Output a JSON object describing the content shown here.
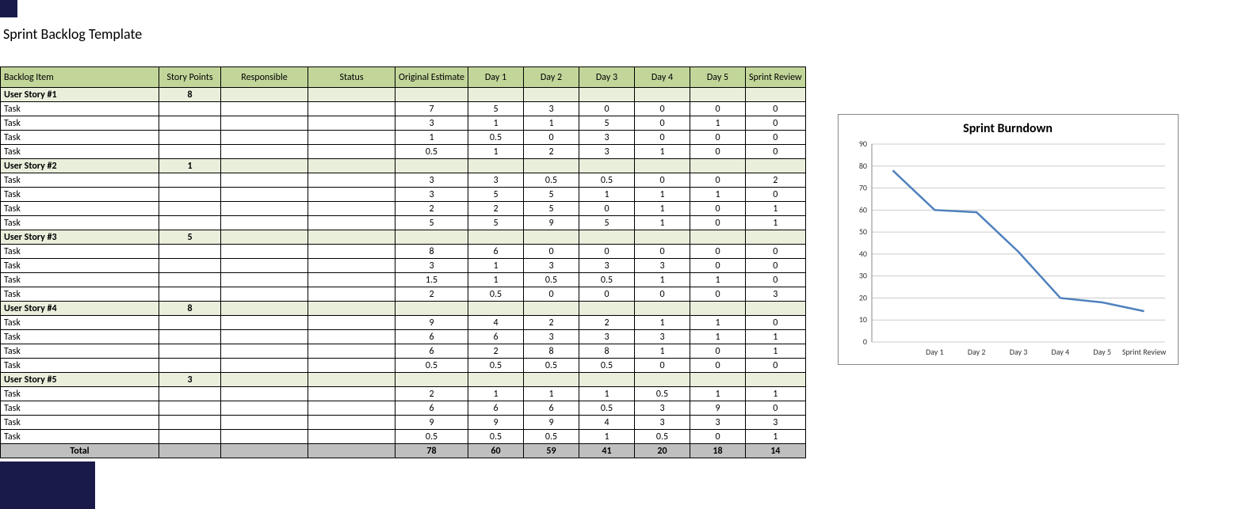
{
  "title": "Sprint Backlog Template",
  "headers": [
    "Backlog Item",
    "Story Points",
    "Responsible",
    "Status",
    "Original Estimate",
    "Day 1",
    "Day 2",
    "Day 3",
    "Day 4",
    "Day 5",
    "Sprint Review"
  ],
  "stories": [
    {
      "name": "User Story #1",
      "points": "8",
      "tasks": [
        {
          "name": "Task",
          "vals": [
            "7",
            "5",
            "3",
            "0",
            "0",
            "0",
            "0"
          ]
        },
        {
          "name": "Task",
          "vals": [
            "3",
            "1",
            "1",
            "5",
            "0",
            "1",
            "0"
          ]
        },
        {
          "name": "Task",
          "vals": [
            "1",
            "0.5",
            "0",
            "3",
            "0",
            "0",
            "0"
          ]
        },
        {
          "name": "Task",
          "vals": [
            "0.5",
            "1",
            "2",
            "3",
            "1",
            "0",
            "0"
          ]
        }
      ]
    },
    {
      "name": "User Story #2",
      "points": "1",
      "tasks": [
        {
          "name": "Task",
          "vals": [
            "3",
            "3",
            "0.5",
            "0.5",
            "0",
            "0",
            "2"
          ]
        },
        {
          "name": "Task",
          "vals": [
            "3",
            "5",
            "5",
            "1",
            "1",
            "1",
            "0"
          ]
        },
        {
          "name": "Task",
          "vals": [
            "2",
            "2",
            "5",
            "0",
            "1",
            "0",
            "1"
          ]
        },
        {
          "name": "Task",
          "vals": [
            "5",
            "5",
            "9",
            "5",
            "1",
            "0",
            "1"
          ]
        }
      ]
    },
    {
      "name": "User Story #3",
      "points": "5",
      "tasks": [
        {
          "name": "Task",
          "vals": [
            "8",
            "6",
            "0",
            "0",
            "0",
            "0",
            "0"
          ]
        },
        {
          "name": "Task",
          "vals": [
            "3",
            "1",
            "3",
            "3",
            "3",
            "0",
            "0"
          ]
        },
        {
          "name": "Task",
          "vals": [
            "1.5",
            "1",
            "0.5",
            "0.5",
            "1",
            "1",
            "0"
          ]
        },
        {
          "name": "Task",
          "vals": [
            "2",
            "0.5",
            "0",
            "0",
            "0",
            "0",
            "3"
          ]
        }
      ]
    },
    {
      "name": "User Story #4",
      "points": "8",
      "tasks": [
        {
          "name": "Task",
          "vals": [
            "9",
            "4",
            "2",
            "2",
            "1",
            "1",
            "0"
          ]
        },
        {
          "name": "Task",
          "vals": [
            "6",
            "6",
            "3",
            "3",
            "3",
            "1",
            "1"
          ]
        },
        {
          "name": "Task",
          "vals": [
            "6",
            "2",
            "8",
            "8",
            "1",
            "0",
            "1"
          ]
        },
        {
          "name": "Task",
          "vals": [
            "0.5",
            "0.5",
            "0.5",
            "0.5",
            "0",
            "0",
            "0"
          ]
        }
      ]
    },
    {
      "name": "User Story #5",
      "points": "3",
      "tasks": [
        {
          "name": "Task",
          "vals": [
            "2",
            "1",
            "1",
            "1",
            "0.5",
            "1",
            "1"
          ]
        },
        {
          "name": "Task",
          "vals": [
            "6",
            "6",
            "6",
            "0.5",
            "3",
            "9",
            "0"
          ]
        },
        {
          "name": "Task",
          "vals": [
            "9",
            "9",
            "9",
            "4",
            "3",
            "3",
            "3"
          ]
        },
        {
          "name": "Task",
          "vals": [
            "0.5",
            "0.5",
            "0.5",
            "1",
            "0.5",
            "0",
            "1"
          ]
        }
      ]
    }
  ],
  "total": {
    "label": "Total",
    "vals": [
      "78",
      "60",
      "59",
      "41",
      "20",
      "18",
      "14"
    ]
  },
  "chart_data": {
    "type": "line",
    "title": "Sprint Burndown",
    "categories": [
      "Day 1",
      "Day 2",
      "Day 3",
      "Day 4",
      "Day 5",
      "Sprint Review"
    ],
    "values": [
      78,
      60,
      59,
      41,
      20,
      18,
      14
    ],
    "ylim": [
      0,
      90
    ],
    "yticks": [
      0,
      10,
      20,
      30,
      40,
      50,
      60,
      70,
      80,
      90
    ]
  }
}
